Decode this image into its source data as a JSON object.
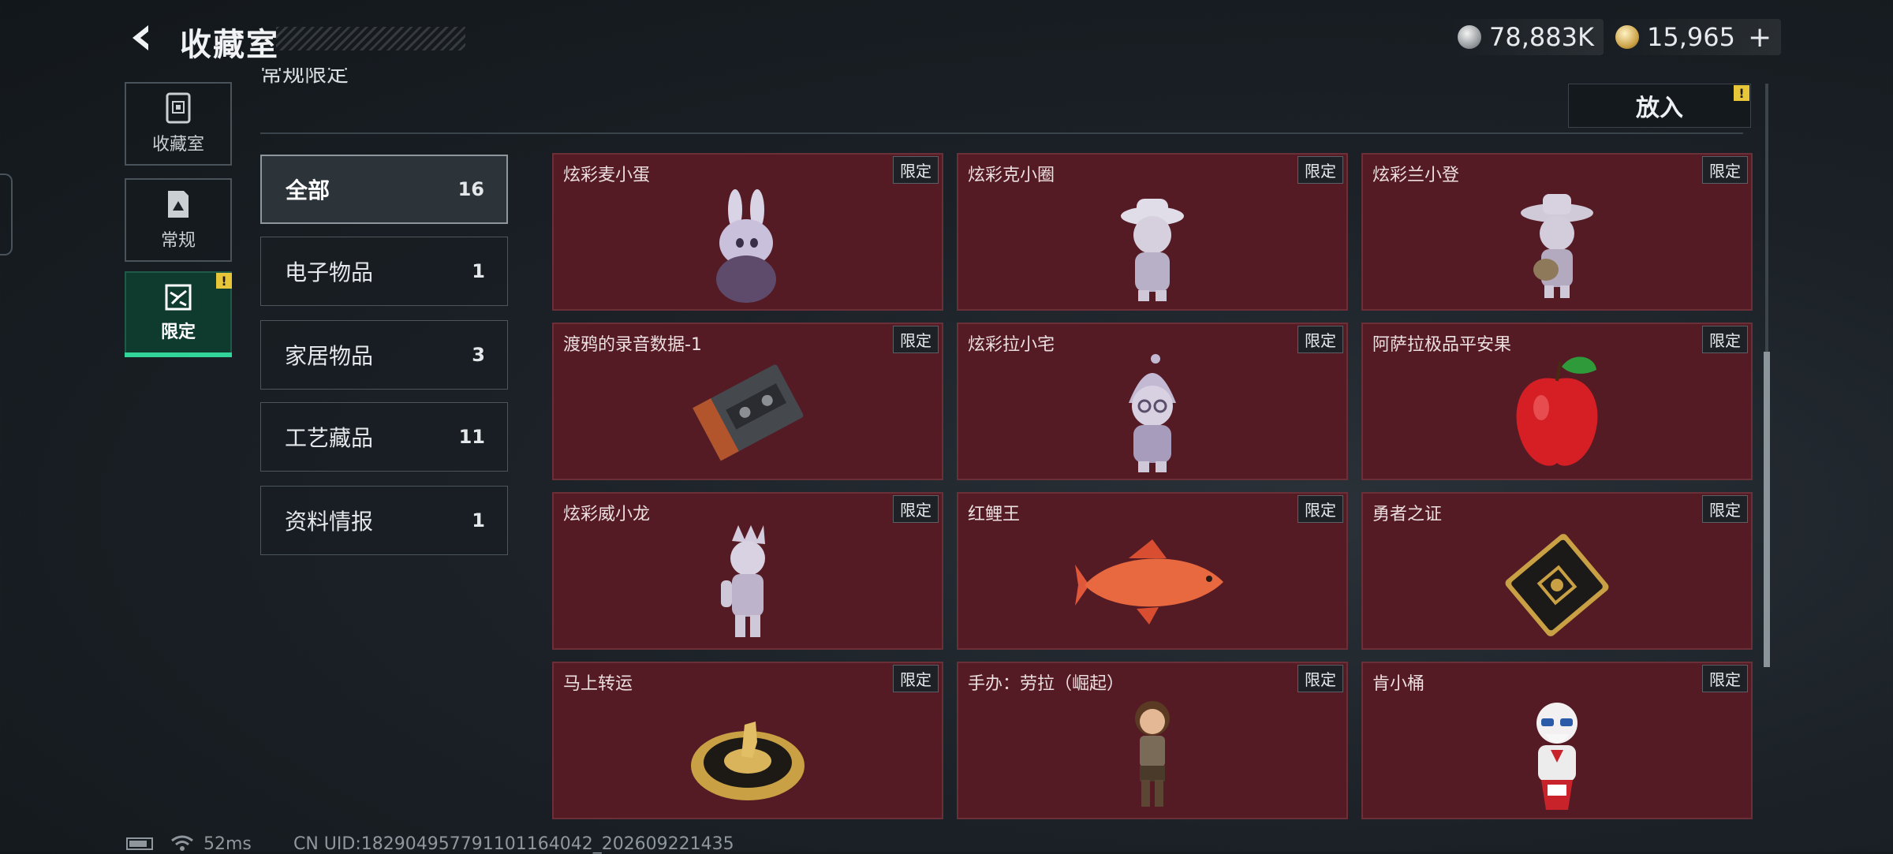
{
  "header": {
    "title": "收藏室",
    "currencies": [
      {
        "icon": "silver-coin-icon",
        "value": "78,883K"
      },
      {
        "icon": "gold-coin-icon",
        "value": "15,965"
      }
    ],
    "plus_label": "+"
  },
  "nav": [
    {
      "label": "收藏室",
      "icon": "archive-icon"
    },
    {
      "label": "常规",
      "icon": "document-icon"
    },
    {
      "label": "限定",
      "icon": "limited-icon",
      "active": true
    }
  ],
  "warning_mark": "!",
  "section_title": "常规限定",
  "put_button": "放入",
  "categories": [
    {
      "name": "全部",
      "count": "16",
      "active": true
    },
    {
      "name": "电子物品",
      "count": "1"
    },
    {
      "name": "家居物品",
      "count": "3"
    },
    {
      "name": "工艺藏品",
      "count": "11"
    },
    {
      "name": "资料情报",
      "count": "1"
    }
  ],
  "badge_label": "限定",
  "items": [
    {
      "name": "炫彩麦小蛋",
      "art": "bunny-egg-figure"
    },
    {
      "name": "炫彩克小圈",
      "art": "hat-girl-figure"
    },
    {
      "name": "炫彩兰小登",
      "art": "sombrero-guitar-figure"
    },
    {
      "name": "渡鸦的录音数据-1",
      "art": "cassette-tape"
    },
    {
      "name": "炫彩拉小宅",
      "art": "hooded-figure"
    },
    {
      "name": "阿萨拉极品平安果",
      "art": "red-apple"
    },
    {
      "name": "炫彩威小龙",
      "art": "dragon-figure"
    },
    {
      "name": "红鲤王",
      "art": "red-carp"
    },
    {
      "name": "勇者之证",
      "art": "gold-card"
    },
    {
      "name": "马上转运",
      "art": "golden-horse-dial"
    },
    {
      "name": "手办：劳拉（崛起）",
      "art": "lara-figure"
    },
    {
      "name": "肯小桶",
      "art": "colonel-figure"
    }
  ],
  "status": {
    "ping": "52ms",
    "uid": "CN UID:18290495779110116404‌2_202609221435"
  },
  "colors": {
    "card_bg": "#541b24",
    "accent_green": "#33d49a",
    "warning_yellow": "#e8c63a"
  }
}
